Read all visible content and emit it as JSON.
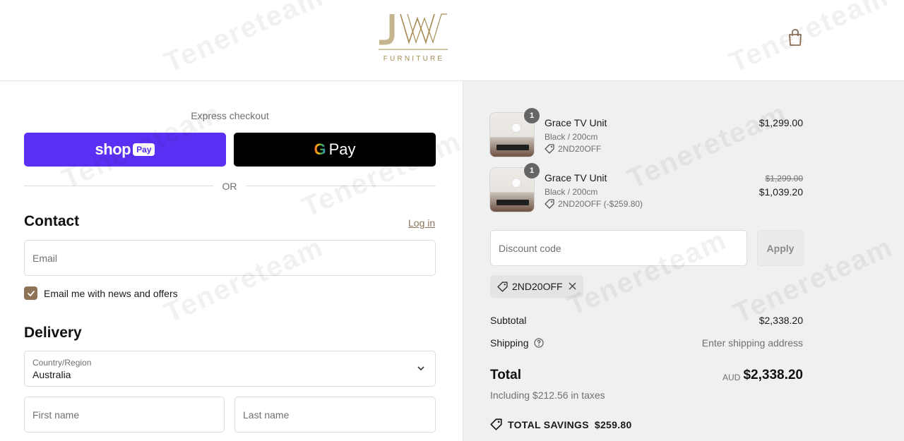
{
  "header": {
    "logo_text": "JW",
    "logo_subtext": "FURNITURE",
    "cart_icon": "shopping-bag-icon"
  },
  "watermark": {
    "text": "Tenereteam"
  },
  "express": {
    "label": "Express checkout",
    "shop_pay_word": "shop",
    "shop_pay_badge": "Pay",
    "gpay_g": "G",
    "gpay_pay": "Pay",
    "or_label": "OR"
  },
  "contact": {
    "title": "Contact",
    "login_label": "Log in",
    "email_placeholder": "Email",
    "newsletter_label": "Email me with news and offers",
    "newsletter_checked": true
  },
  "delivery": {
    "title": "Delivery",
    "country_label": "Country/Region",
    "country_value": "Australia",
    "first_name_placeholder": "First name",
    "last_name_placeholder": "Last name"
  },
  "cart": {
    "items": [
      {
        "quantity": "1",
        "name": "Grace TV Unit",
        "variant": "Black / 200cm",
        "discount": "2ND20OFF",
        "price": "$1,299.00",
        "original_price": ""
      },
      {
        "quantity": "1",
        "name": "Grace TV Unit",
        "variant": "Black / 200cm",
        "discount": "2ND20OFF (-$259.80)",
        "price": "$1,039.20",
        "original_price": "$1,299.00"
      }
    ]
  },
  "discount": {
    "placeholder": "Discount code",
    "apply_label": "Apply",
    "applied_code": "2ND20OFF"
  },
  "summary": {
    "subtotal_label": "Subtotal",
    "subtotal_value": "$2,338.20",
    "shipping_label": "Shipping",
    "shipping_value": "Enter shipping address",
    "total_label": "Total",
    "currency": "AUD",
    "total_value": "$2,338.20",
    "taxes_note": "Including $212.56 in taxes",
    "savings_label": "TOTAL SAVINGS",
    "savings_value": "$259.80"
  },
  "colors": {
    "shop_pay": "#5a31f4",
    "gpay": "#000000",
    "accent": "#8e7357",
    "logo_gold": "#a58a52",
    "summary_bg": "#f0f0f0"
  }
}
